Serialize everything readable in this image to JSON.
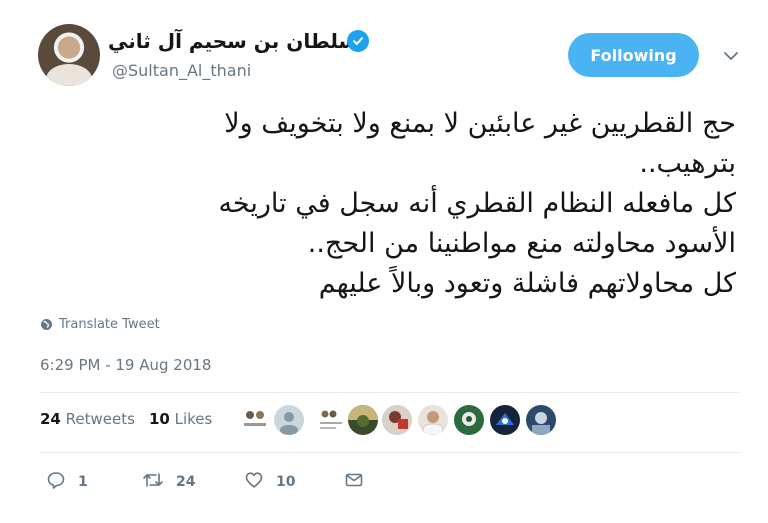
{
  "user": {
    "display_name": "سلطان بن سحيم آل ثاني",
    "handle": "@Sultan_Al_thani",
    "verified": true
  },
  "follow_button": {
    "label": "Following",
    "color": "#4ab3f4"
  },
  "tweet": {
    "lines": [
      "حج القطريين غير عابئين لا بمنع ولا بتخويف ولا",
      "بترهيب..",
      "كل مافعله النظام القطري أنه سجل في تاريخه",
      "الأسود محاولته منع مواطنينا من الحج..",
      "كل محاولاتهم فاشلة وتعود وبالاً عليهم"
    ]
  },
  "translate_label": "Translate Tweet",
  "timestamp": "6:29 PM - 19 Aug 2018",
  "stats": {
    "retweets_count": "24",
    "retweets_label": "Retweets",
    "likes_count": "10",
    "likes_label": "Likes"
  },
  "actions": {
    "reply_count": "1",
    "retweet_count": "24",
    "like_count": "10"
  },
  "colors": {
    "accent": "#1da1f2",
    "muted": "#657786",
    "text": "#14171a",
    "divider": "#e6ecf0"
  }
}
